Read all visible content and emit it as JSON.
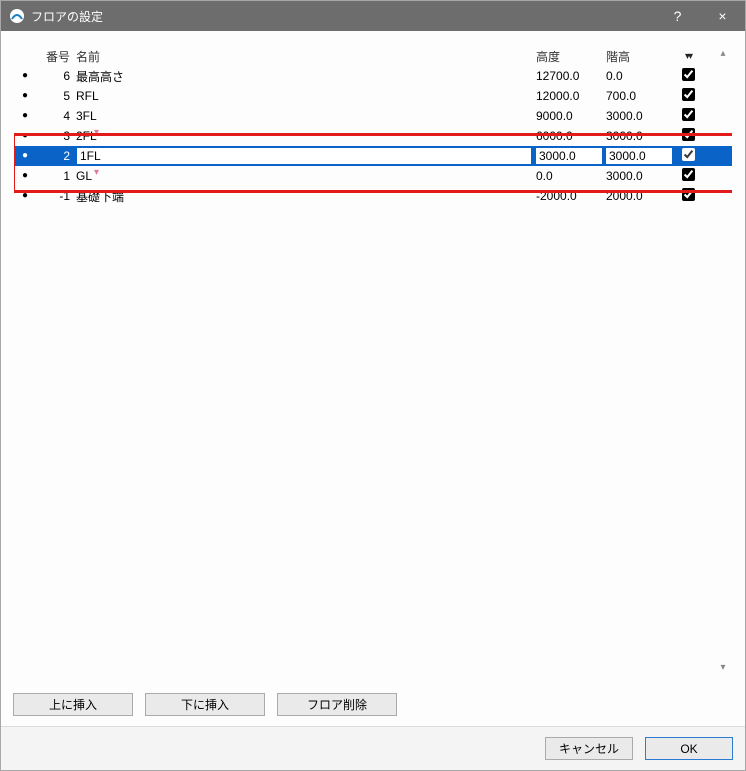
{
  "titlebar": {
    "title": "フロアの設定",
    "help_label": "?",
    "close_label": "×"
  },
  "columns": {
    "bullet": "",
    "number": "番号",
    "name": "名前",
    "elevation": "高度",
    "height": "階高",
    "sort_icons": "▾▾"
  },
  "rows": [
    {
      "num": "6",
      "name": "最高高さ",
      "elevation": "12700.0",
      "height": "0.0",
      "checked": true,
      "selected": false,
      "editing": false
    },
    {
      "num": "5",
      "name": "RFL",
      "elevation": "12000.0",
      "height": "700.0",
      "checked": true,
      "selected": false,
      "editing": false
    },
    {
      "num": "4",
      "name": "3FL",
      "elevation": "9000.0",
      "height": "3000.0",
      "checked": true,
      "selected": false,
      "editing": false
    },
    {
      "num": "3",
      "name": "2FL",
      "elevation": "6000.0",
      "height": "3000.0",
      "checked": true,
      "selected": false,
      "editing": false
    },
    {
      "num": "2",
      "name": "1FL",
      "elevation": "3000.0",
      "height": "3000.0",
      "checked": true,
      "selected": true,
      "editing": true
    },
    {
      "num": "1",
      "name": "GL",
      "elevation": "0.0",
      "height": "3000.0",
      "checked": true,
      "selected": false,
      "editing": false
    },
    {
      "num": "-1",
      "name": "基礎下端",
      "elevation": "-2000.0",
      "height": "2000.0",
      "checked": true,
      "selected": false,
      "editing": false
    }
  ],
  "buttons": {
    "insert_above": "上に挿入",
    "insert_below": "下に挿入",
    "delete_floor": "フロア削除",
    "cancel": "キャンセル",
    "ok": "OK"
  }
}
